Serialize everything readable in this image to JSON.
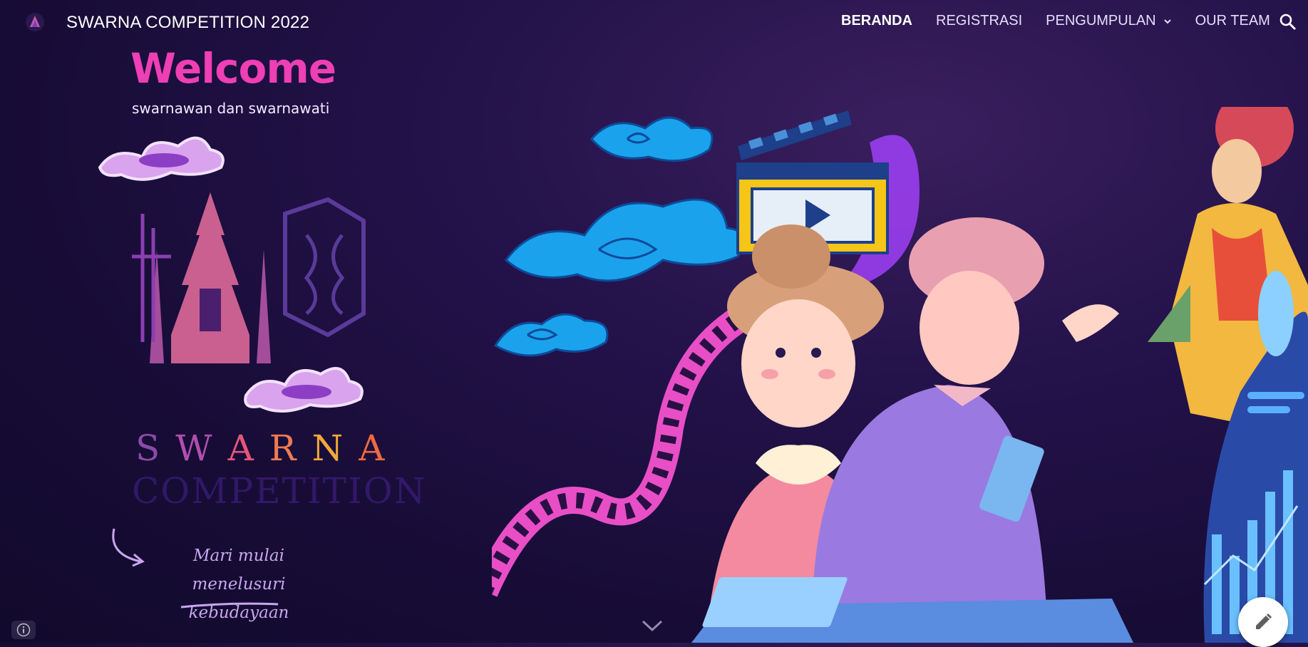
{
  "header": {
    "site_title": "SWARNA COMPETITION 2022",
    "logo_icon": "swarna-logo-icon",
    "search_icon": "search-icon"
  },
  "nav": {
    "items": [
      {
        "label": "BERANDA",
        "active": true
      },
      {
        "label": "REGISTRASI",
        "active": false
      },
      {
        "label": "PENGUMPULAN",
        "active": false,
        "has_dropdown": true
      },
      {
        "label": "OUR TEAM",
        "active": false
      }
    ]
  },
  "hero": {
    "welcome": "Welcome",
    "subtitle": "swarnawan dan swarnawati",
    "brand_letters": [
      "S",
      "W",
      "A",
      "R",
      "N",
      "A"
    ],
    "brand_second_line": "COMPETITION",
    "tagline_line1": "Mari mulai menelusuri",
    "tagline_line2": "kebudayaan"
  },
  "colors": {
    "accent_pink": "#ee3fb4",
    "bg_dark": "#170c36",
    "cloud_blue": "#1aa3ec",
    "purple": "#7a3fb8"
  },
  "footer": {
    "info_icon": "info-icon",
    "edit_icon": "pencil-icon",
    "scroll_icon": "chevron-down-icon"
  }
}
